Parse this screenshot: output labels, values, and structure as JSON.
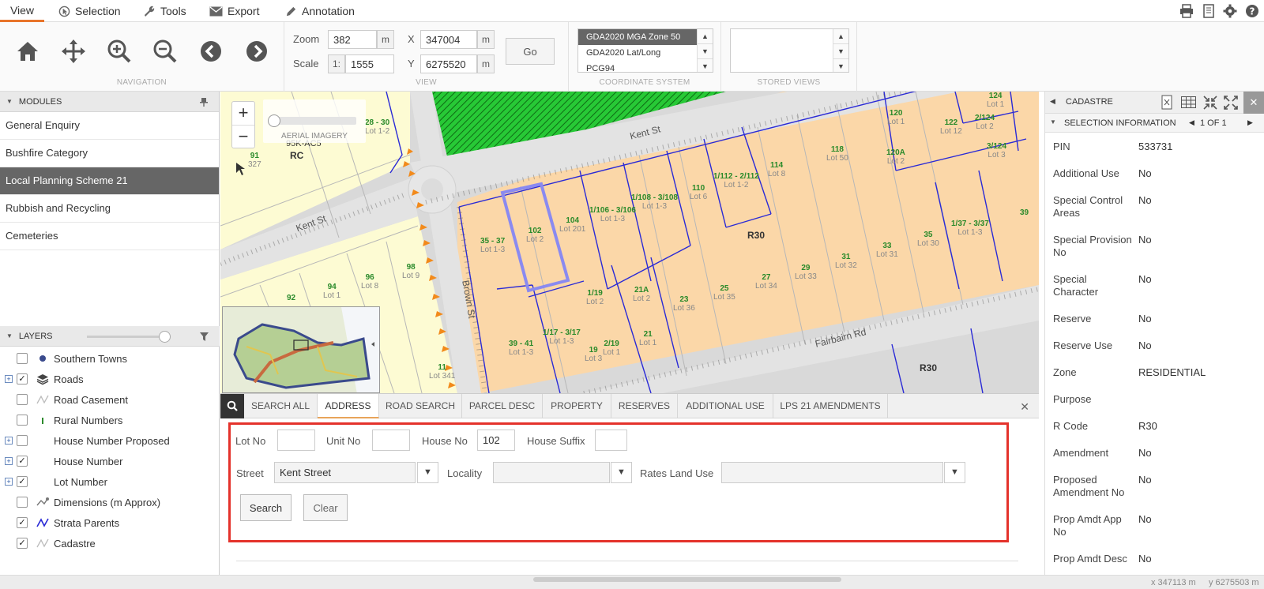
{
  "menu": {
    "tabs": [
      {
        "label": "View",
        "active": true
      },
      {
        "label": "Selection"
      },
      {
        "label": "Tools"
      },
      {
        "label": "Export"
      },
      {
        "label": "Annotation"
      }
    ]
  },
  "toolbar": {
    "navigation_caption": "NAVIGATION",
    "view_caption": "VIEW",
    "coord_caption": "COORDINATE SYSTEM",
    "stored_caption": "STORED VIEWS",
    "zoom_label": "Zoom",
    "zoom_value": "382",
    "zoom_unit": "m",
    "scale_label": "Scale",
    "scale_prefix": "1:",
    "scale_value": "1555",
    "x_label": "X",
    "x_value": "347004",
    "x_unit": "m",
    "y_label": "Y",
    "y_value": "6275520",
    "y_unit": "m",
    "go_label": "Go",
    "coord_options": [
      "GDA2020 MGA Zone 50",
      "GDA2020 Lat/Long",
      "PCG94"
    ]
  },
  "modules": {
    "title": "MODULES",
    "items": [
      {
        "label": "General Enquiry"
      },
      {
        "label": "Bushfire Category"
      },
      {
        "label": "Local Planning Scheme 21",
        "selected": true
      },
      {
        "label": "Rubbish and Recycling"
      },
      {
        "label": "Cemeteries"
      }
    ]
  },
  "layers": {
    "title": "LAYERS",
    "items": [
      {
        "label": "Southern Towns",
        "checked": false,
        "plus": false,
        "icon": "dot-icon"
      },
      {
        "label": "Roads",
        "checked": true,
        "plus": true,
        "icon": "layers-icon"
      },
      {
        "label": "Road Casement",
        "checked": false,
        "plus": false,
        "icon": "line-icon"
      },
      {
        "label": "Rural Numbers",
        "checked": false,
        "plus": false,
        "icon": "marker-icon"
      },
      {
        "label": "House Number Proposed",
        "checked": false,
        "plus": true,
        "icon": ""
      },
      {
        "label": "House Number",
        "checked": true,
        "plus": true,
        "icon": ""
      },
      {
        "label": "Lot Number",
        "checked": true,
        "plus": true,
        "icon": ""
      },
      {
        "label": "Dimensions (m Approx)",
        "checked": false,
        "plus": false,
        "icon": "dimension-icon"
      },
      {
        "label": "Strata Parents",
        "checked": true,
        "plus": false,
        "icon": "zigzag-blue-icon"
      },
      {
        "label": "Cadastre",
        "checked": true,
        "plus": false,
        "icon": "zigzag-grey-icon"
      }
    ]
  },
  "map": {
    "aerial_label": "AERIAL IMAGERY",
    "streets": {
      "kent_top": "Kent St",
      "kent_left": "Kent St",
      "brown": "Brown St",
      "fairbairn": "Fairbairn Rd"
    },
    "zones": {
      "rc": "RC",
      "r30_a": "R30",
      "r30_b": "R30",
      "rc_top": "95K-AC5"
    },
    "lots": [
      {
        "num": "28 - 30",
        "lot": "Lot 1-2"
      },
      {
        "num": "91",
        "lot": "327"
      },
      {
        "num": "35 - 37",
        "lot": "Lot 1-3"
      },
      {
        "num": "102",
        "lot": "Lot 2"
      },
      {
        "num": "104",
        "lot": "Lot 201"
      },
      {
        "num": "1/106 - 3/106",
        "lot": "Lot 1-3"
      },
      {
        "num": "1/108 - 3/108",
        "lot": "Lot 1-3"
      },
      {
        "num": "110",
        "lot": "Lot 6"
      },
      {
        "num": "1/112 - 2/112",
        "lot": "Lot 1-2"
      },
      {
        "num": "114",
        "lot": "Lot 8"
      },
      {
        "num": "118",
        "lot": "Lot 50"
      },
      {
        "num": "120",
        "lot": "Lot 1"
      },
      {
        "num": "120A",
        "lot": "Lot 2"
      },
      {
        "num": "122",
        "lot": "Lot 12"
      },
      {
        "num": "2/124",
        "lot": "Lot 2"
      },
      {
        "num": "3/124",
        "lot": "Lot 3"
      },
      {
        "num": "124",
        "lot": "Lot 1"
      },
      {
        "num": "39",
        "lot": ""
      },
      {
        "num": "1/37 - 3/37",
        "lot": "Lot 1-3"
      },
      {
        "num": "35",
        "lot": "Lot 30"
      },
      {
        "num": "33",
        "lot": "Lot 31"
      },
      {
        "num": "31",
        "lot": "Lot 32"
      },
      {
        "num": "29",
        "lot": "Lot 33"
      },
      {
        "num": "27",
        "lot": "Lot 34"
      },
      {
        "num": "25",
        "lot": "Lot 35"
      },
      {
        "num": "23",
        "lot": "Lot 36"
      },
      {
        "num": "21A",
        "lot": "Lot 2"
      },
      {
        "num": "1/19",
        "lot": "Lot 2"
      },
      {
        "num": "21",
        "lot": "Lot 1"
      },
      {
        "num": "2/19",
        "lot": "Lot 1"
      },
      {
        "num": "19",
        "lot": "Lot 3"
      },
      {
        "num": "1/17 - 3/17",
        "lot": "Lot 1-3"
      },
      {
        "num": "39 - 41",
        "lot": "Lot 1-3"
      },
      {
        "num": "98",
        "lot": "Lot 9"
      },
      {
        "num": "96",
        "lot": "Lot 8"
      },
      {
        "num": "94",
        "lot": "Lot 1"
      },
      {
        "num": "92",
        "lot": ""
      },
      {
        "num": "11",
        "lot": "Lot 341"
      }
    ]
  },
  "search": {
    "tabs": [
      "SEARCH ALL",
      "ADDRESS",
      "ROAD SEARCH",
      "PARCEL DESC",
      "PROPERTY",
      "RESERVES",
      "ADDITIONAL USE",
      "LPS 21 AMENDMENTS"
    ],
    "active_tab": "ADDRESS",
    "lot_no_label": "Lot No",
    "lot_no_value": "",
    "unit_no_label": "Unit No",
    "unit_no_value": "",
    "house_no_label": "House No",
    "house_no_value": "102",
    "house_suffix_label": "House Suffix",
    "house_suffix_value": "",
    "street_label": "Street",
    "street_value": "Kent Street",
    "locality_label": "Locality",
    "locality_value": "",
    "rates_label": "Rates Land Use",
    "rates_value": "",
    "search_button": "Search",
    "clear_button": "Clear"
  },
  "cadastre": {
    "title": "CADASTRE",
    "section": "SELECTION INFORMATION",
    "pager": "1 OF 1",
    "attributes": [
      {
        "key": "PIN",
        "value": "533731"
      },
      {
        "key": "Additional Use",
        "value": "No"
      },
      {
        "key": "Special Control Areas",
        "value": "No"
      },
      {
        "key": "Special Provision No",
        "value": "No"
      },
      {
        "key": "Special Character",
        "value": "No"
      },
      {
        "key": "Reserve",
        "value": "No"
      },
      {
        "key": "Reserve Use",
        "value": "No"
      },
      {
        "key": "Zone",
        "value": "RESIDENTIAL"
      },
      {
        "key": "Purpose",
        "value": ""
      },
      {
        "key": "R Code",
        "value": "R30"
      },
      {
        "key": "Amendment",
        "value": "No"
      },
      {
        "key": "Proposed Amendment No",
        "value": "No"
      },
      {
        "key": "Prop Amdt App No",
        "value": "No"
      },
      {
        "key": "Prop Amdt Desc",
        "value": "No"
      }
    ]
  },
  "status": {
    "x_coord": "x 347113 m",
    "y_coord": "y 6275503 m"
  },
  "colors": {
    "accent": "#e8742a",
    "highlight_box": "#e4322b",
    "selected_item": "#666666",
    "parcel_fill": "#fbd7a8",
    "parcel_line": "#2a2ad6",
    "rc_fill": "#fdfbd3",
    "reserve_green": "#27c936"
  }
}
